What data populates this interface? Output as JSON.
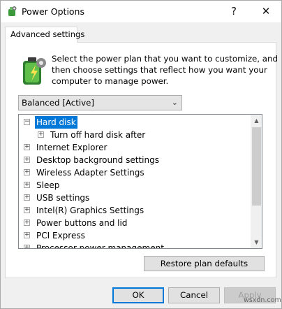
{
  "window": {
    "title": "Power Options",
    "help_label": "?",
    "close_label": "✕"
  },
  "tabs": [
    {
      "label": "Advanced settings",
      "active": true
    }
  ],
  "intro": {
    "lines": [
      "Select the power plan that you want to customize, and",
      "then choose settings that reflect how you want your",
      "computer to manage power."
    ]
  },
  "plan_select": {
    "value": "Balanced [Active]",
    "arrow": "⌄"
  },
  "tree": {
    "items": [
      {
        "label": "Hard disk",
        "expander": "−",
        "level": 0,
        "selected": true
      },
      {
        "label": "Turn off hard disk after",
        "expander": "+",
        "level": 1,
        "selected": false
      },
      {
        "label": "Internet Explorer",
        "expander": "+",
        "level": 0,
        "selected": false
      },
      {
        "label": "Desktop background settings",
        "expander": "+",
        "level": 0,
        "selected": false
      },
      {
        "label": "Wireless Adapter Settings",
        "expander": "+",
        "level": 0,
        "selected": false
      },
      {
        "label": "Sleep",
        "expander": "+",
        "level": 0,
        "selected": false
      },
      {
        "label": "USB settings",
        "expander": "+",
        "level": 0,
        "selected": false
      },
      {
        "label": "Intel(R) Graphics Settings",
        "expander": "+",
        "level": 0,
        "selected": false
      },
      {
        "label": "Power buttons and lid",
        "expander": "+",
        "level": 0,
        "selected": false
      },
      {
        "label": "PCI Express",
        "expander": "+",
        "level": 0,
        "selected": false
      },
      {
        "label": "Processor power management",
        "expander": "+",
        "level": 0,
        "selected": false
      }
    ],
    "scroll_up": "▲",
    "scroll_down": "▼"
  },
  "buttons": {
    "restore": "Restore plan defaults",
    "ok": "OK",
    "cancel": "Cancel",
    "apply": "Apply"
  },
  "watermark": "wsxdn.com",
  "colors": {
    "selection": "#0078d7",
    "default_button_border": "#0078d7",
    "disabled_text": "#a0a0a0"
  }
}
